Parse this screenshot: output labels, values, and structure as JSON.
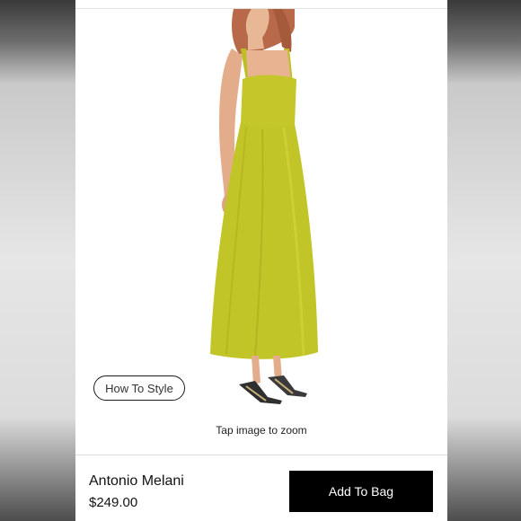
{
  "product": {
    "howto_label": "How To Style",
    "zoom_hint": "Tap image to zoom",
    "brand": "Antonio Melani",
    "price": "$249.00"
  },
  "actions": {
    "add_to_bag_label": "Add To Bag"
  },
  "colors": {
    "dress": "#c4c62a",
    "button_bg": "#000000"
  }
}
